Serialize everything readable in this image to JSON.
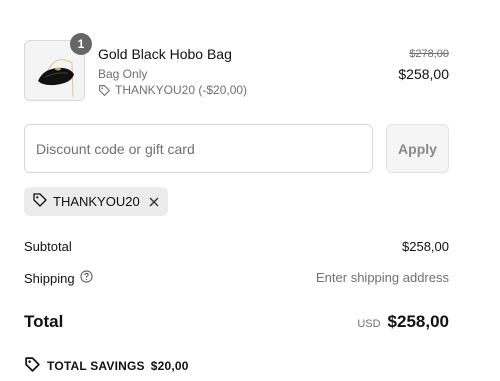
{
  "line_item": {
    "name": "Gold Black Hobo Bag",
    "variant": "Bag Only",
    "discount_label": "THANKYOU20 (-$20,00)",
    "quantity": "1",
    "original_price": "$278,00",
    "price": "$258,00"
  },
  "discount": {
    "placeholder": "Discount code or gift card",
    "value": "",
    "apply_label": "Apply",
    "applied_code": "THANKYOU20"
  },
  "summary": {
    "subtotal_label": "Subtotal",
    "subtotal_value": "$258,00",
    "shipping_label": "Shipping",
    "shipping_value": "Enter shipping address",
    "total_label": "Total",
    "total_currency": "USD",
    "total_value": "$258,00",
    "savings_label": "TOTAL SAVINGS",
    "savings_value": "$20,00"
  },
  "icons": {
    "tag": "tag-icon",
    "help": "question-circle-icon",
    "remove": "close-icon",
    "savings_tag": "tag-icon"
  },
  "colors": {
    "text": "#111111",
    "muted": "#707070",
    "badge": "#666666",
    "chip_bg": "#ececec"
  }
}
